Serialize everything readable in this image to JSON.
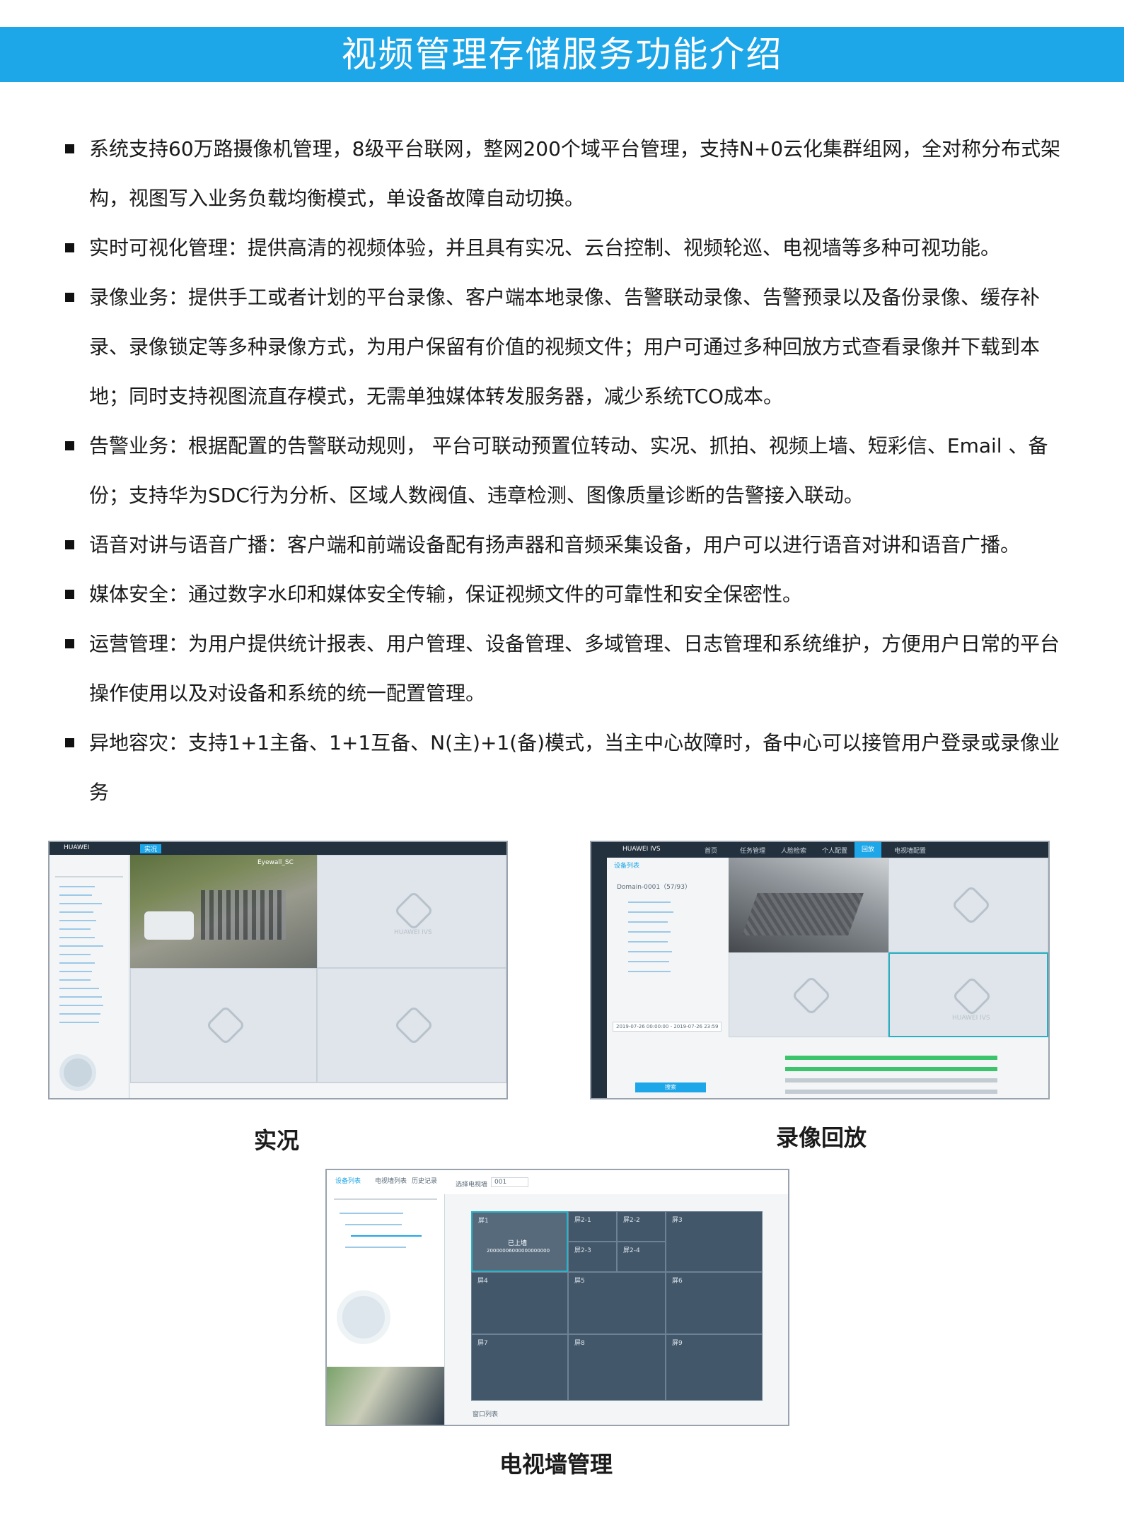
{
  "title": "视频管理存储服务功能介绍",
  "bullets": [
    "系统支持60万路摄像机管理，8级平台联网，整网200个域平台管理，支持N+0云化集群组网，全对称分布式架构，视图写入业务负载均衡模式，单设备故障自动切换。",
    "实时可视化管理：提供高清的视频体验，并且具有实况、云台控制、视频轮巡、电视墙等多种可视功能。",
    "录像业务：提供手工或者计划的平台录像、客户端本地录像、告警联动录像、告警预录以及备份录像、缓存补录、录像锁定等多种录像方式，为用户保留有价值的视频文件；用户可通过多种回放方式查看录像并下载到本地；同时支持视图流直存模式，无需单独媒体转发服务器，减少系统TCO成本。",
    "告警业务：根据配置的告警联动规则， 平台可联动预置位转动、实况、抓拍、视频上墙、短彩信、Email 、备份；支持华为SDC行为分析、区域人数阀值、违章检测、图像质量诊断的告警接入联动。",
    "语音对讲与语音广播：客户端和前端设备配有扬声器和音频采集设备，用户可以进行语音对讲和语音广播。",
    "媒体安全：通过数字水印和媒体安全传输，保证视频文件的可靠性和安全保密性。",
    "运营管理：为用户提供统计报表、用户管理、设备管理、多域管理、日志管理和系统维护，方便用户日常的平台操作使用以及对设备和系统的统一配置管理。",
    "异地容灾：支持1+1主备、1+1互备、N(主)+1(备)模式，当主中心故障时，备中心可以接管用户登录或录像业务"
  ],
  "captions": {
    "live": "实况",
    "playback": "录像回放",
    "tvwall": "电视墙管理"
  },
  "screenshots": {
    "live": {
      "brand": "HUAWEI",
      "tab": "实况",
      "cam_label": "Eyewall_SC",
      "watermark": "HUAWEI IVS"
    },
    "playback": {
      "brand": "HUAWEI IVS",
      "nav": [
        "首页",
        "任务管理",
        "人脸检索",
        "个人配置",
        "回放",
        "电视墙配置"
      ],
      "device_tab": "设备列表",
      "domain": "Domain-0001（57/93）",
      "timestamp": "2019-07-26 00:00:00 - 2019-07-26 23:59",
      "search_btn": "搜索",
      "watermark": "HUAWEI IVS"
    },
    "tvwall": {
      "tabs": [
        "设备列表",
        "电视墙列表",
        "历史记录"
      ],
      "toolbar_label": "选择电视墙",
      "toolbar_value": "001",
      "on_wall": "已上墙",
      "on_wall_id": "20000006000000000000",
      "tiles": [
        "屏1",
        "屏2-1",
        "屏2-2",
        "屏3",
        "屏2-3",
        "屏2-4",
        "屏4",
        "屏5",
        "屏6",
        "屏7",
        "屏8",
        "屏9"
      ],
      "footer": "窗口列表"
    }
  },
  "colors": {
    "banner": "#1da6e8",
    "ui_dark": "#23303d",
    "accent": "#1da6e8"
  }
}
